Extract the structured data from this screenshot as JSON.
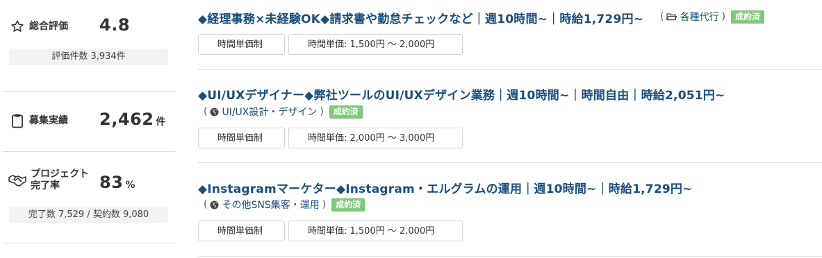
{
  "stats": {
    "rating": {
      "label": "総合評価",
      "value": "4.8",
      "sub": "評価件数 3,934件",
      "icon": "star-outline-icon"
    },
    "recruit": {
      "label": "募集実績",
      "value": "2,462",
      "unit": "件",
      "icon": "clipboard-icon"
    },
    "completion": {
      "label_line1": "プロジェクト",
      "label_line2": "完了率",
      "value": "83",
      "unit": "%",
      "sub": "完了数 7,529 / 契約数 9,080",
      "icon": "handshake-icon"
    }
  },
  "jobs": [
    {
      "title": "◆経理事務×未経験OK◆請求書や勤怠チェックなど｜週10時間~｜時給1,729円~",
      "category": "各種代行",
      "category_icon": "folder-icon",
      "badge": "成約済",
      "tag1": "時間単価制",
      "tag2": "時間単価: 1,500円 〜 2,000円"
    },
    {
      "title": "◆UI/UXデザイナー◆弊社ツールのUI/UXデザイン業務｜週10時間~｜時間自由｜時給2,051円~",
      "category": "UI/UX設計・デザイン",
      "category_icon": "globe-icon",
      "badge": "成約済",
      "tag1": "時間単価制",
      "tag2": "時間単価: 2,000円 〜 3,000円"
    },
    {
      "title": "◆Instagramマーケター◆Instagram・エルグラムの運用｜週10時間~｜時給1,729円~",
      "category": "その他SNS集客・運用",
      "category_icon": "globe-icon",
      "badge": "成約済",
      "tag1": "時間単価制",
      "tag2": "時間単価: 1,500円 〜 2,000円"
    }
  ],
  "paren_open": "(",
  "paren_close": ")",
  "colors": {
    "link": "#1a4e7e",
    "badge": "#7fc97a",
    "divider": "#dddddd",
    "sub_bg": "#f2f2f2"
  }
}
